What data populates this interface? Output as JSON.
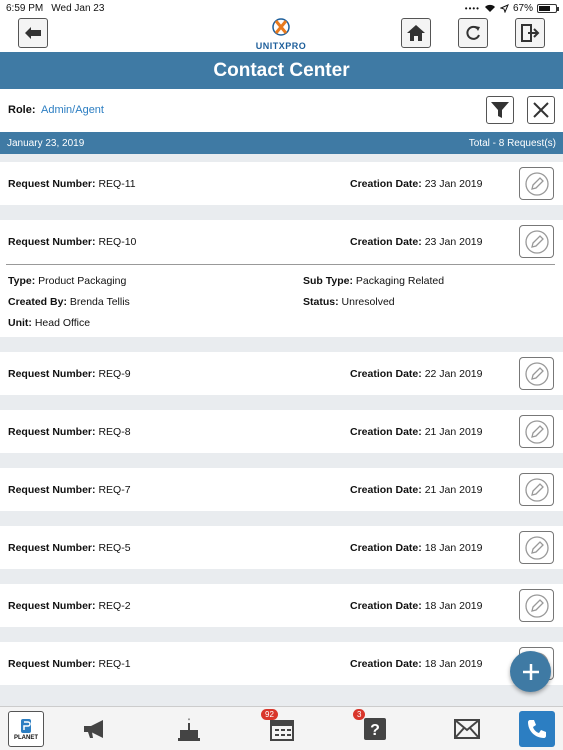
{
  "status_bar": {
    "time": "6:59 PM",
    "date": "Wed Jan 23",
    "battery": "67%"
  },
  "header": {
    "brand": "UNITXPRO",
    "title": "Contact Center"
  },
  "role": {
    "label": "Role:",
    "value": "Admin/Agent"
  },
  "date_bar": {
    "date": "January 23, 2019",
    "total": "Total - 8 Request(s)"
  },
  "labels": {
    "request_number": "Request Number:",
    "creation_date": "Creation Date:",
    "type": "Type:",
    "sub_type": "Sub Type:",
    "created_by": "Created By:",
    "status": "Status:",
    "unit": "Unit:"
  },
  "requests": [
    {
      "number": "REQ-11",
      "date": "23 Jan 2019"
    },
    {
      "number": "REQ-10",
      "date": "23 Jan 2019"
    },
    {
      "number": "REQ-9",
      "date": "22 Jan 2019"
    },
    {
      "number": "REQ-8",
      "date": "21 Jan 2019"
    },
    {
      "number": "REQ-7",
      "date": "21 Jan 2019"
    },
    {
      "number": "REQ-5",
      "date": "18 Jan 2019"
    },
    {
      "number": "REQ-2",
      "date": "18 Jan 2019"
    },
    {
      "number": "REQ-1",
      "date": "18 Jan 2019"
    }
  ],
  "expanded": {
    "type": "Product Packaging",
    "sub_type": "Packaging Related",
    "created_by": "Brenda Tellis",
    "status": "Unresolved",
    "unit": "Head Office"
  },
  "bottom_nav": {
    "planet_label": "PLANET",
    "calendar_badge": "92",
    "help_badge": "3"
  },
  "colors": {
    "primary": "#3f7aa4",
    "link": "#2c7ec2",
    "badge": "#d9362b"
  }
}
